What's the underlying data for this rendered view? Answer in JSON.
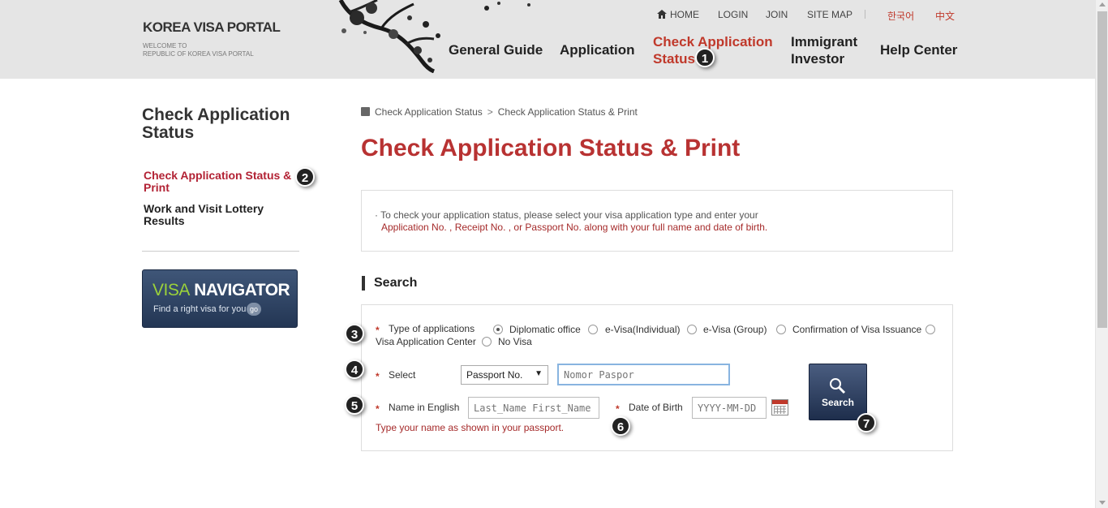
{
  "header": {
    "logo_title": "KOREA VISA PORTAL",
    "logo_sub": "WELCOME TO\nREPUBLIC OF KOREA VISA PORTAL",
    "util": {
      "home": "HOME",
      "login": "LOGIN",
      "join": "JOIN",
      "sitemap": "SITE MAP",
      "korean": "한국어",
      "chinese": "中文"
    },
    "nav": {
      "general": "General Guide",
      "application": "Application",
      "check_line1": "Check Application",
      "check_line2": "Status",
      "immigrant_line1": "Immigrant",
      "immigrant_line2": "Investor",
      "help": "Help Center"
    }
  },
  "sidebar": {
    "title": "Check Application Status",
    "items": [
      {
        "label": "Check Application Status & Print"
      },
      {
        "label": "Work and Visit Lottery Results"
      }
    ],
    "banner": {
      "title_green": "VISA",
      "title_white": "NAVIGATOR",
      "sub": "Find a right visa for you",
      "go": "go"
    }
  },
  "main": {
    "breadcrumb": [
      "Check Application Status",
      "Check Application Status & Print"
    ],
    "breadcrumb_sep": ">",
    "title": "Check Application Status & Print",
    "info": {
      "line1": "· To check your application status, please select your visa application type and enter your",
      "line2": "Application No. , Receipt No. , or Passport No. along with your full name and date of birth."
    },
    "section_title": "Search",
    "form": {
      "type_label": "Type of applications",
      "options": [
        "Diplomatic office",
        "e-Visa(Individual)",
        "e-Visa (Group)",
        "Confirmation of Visa Issuance",
        "Visa Application Center",
        "No Visa"
      ],
      "selected_option": "Diplomatic office",
      "select_label": "Select",
      "select_value": "Passport No.",
      "passport_placeholder": "Nomor Paspor",
      "name_label": "Name in English",
      "name_placeholder": "Last_Name First_Name",
      "dob_label": "Date of Birth",
      "dob_placeholder": "YYYY-MM-DD",
      "hint": "Type your name as shown in your passport.",
      "search_button": "Search"
    }
  },
  "badges": [
    "1",
    "2",
    "3",
    "4",
    "5",
    "6",
    "7"
  ]
}
